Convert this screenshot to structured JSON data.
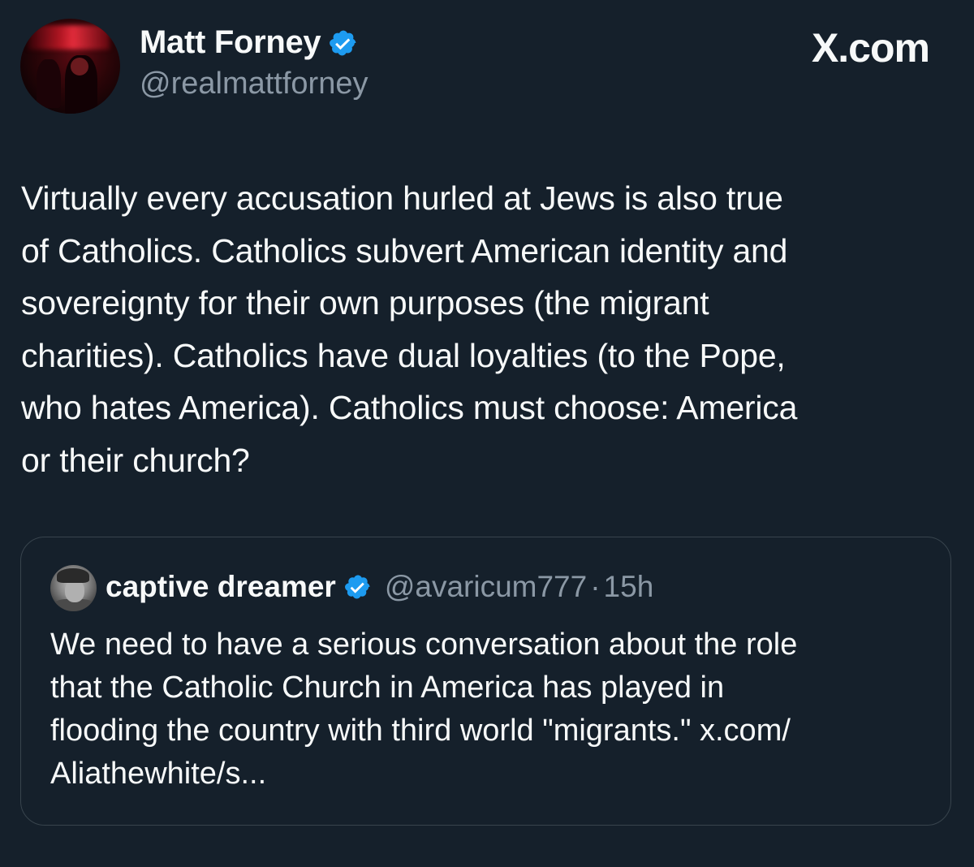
{
  "brand": "X.com",
  "author": {
    "display_name": "Matt Forney",
    "handle": "@realmattforney",
    "verified": true
  },
  "tweet_lines": [
    "Virtually every accusation hurled at Jews is also true",
    "of Catholics. Catholics subvert American identity and",
    "sovereignty for their own purposes (the migrant",
    "charities). Catholics have dual loyalties (to the Pope,",
    "who hates America). Catholics must choose: America",
    "or their church?"
  ],
  "quoted": {
    "display_name": "captive dreamer",
    "handle": "@avaricum777",
    "separator": "·",
    "time": "15h",
    "verified": true,
    "text_lines": [
      "We need to have a serious conversation about the role",
      "that the Catholic Church in America has played in",
      "flooding the country with third world \"migrants.\" x.com/",
      "Aliathewhite/s..."
    ]
  },
  "colors": {
    "background": "#15202b",
    "text": "#f7f9f9",
    "secondary": "#8b98a5",
    "verified_blue": "#1d9bf0",
    "border": "#38444d"
  },
  "icons": {
    "verified": "verified-badge-icon"
  }
}
